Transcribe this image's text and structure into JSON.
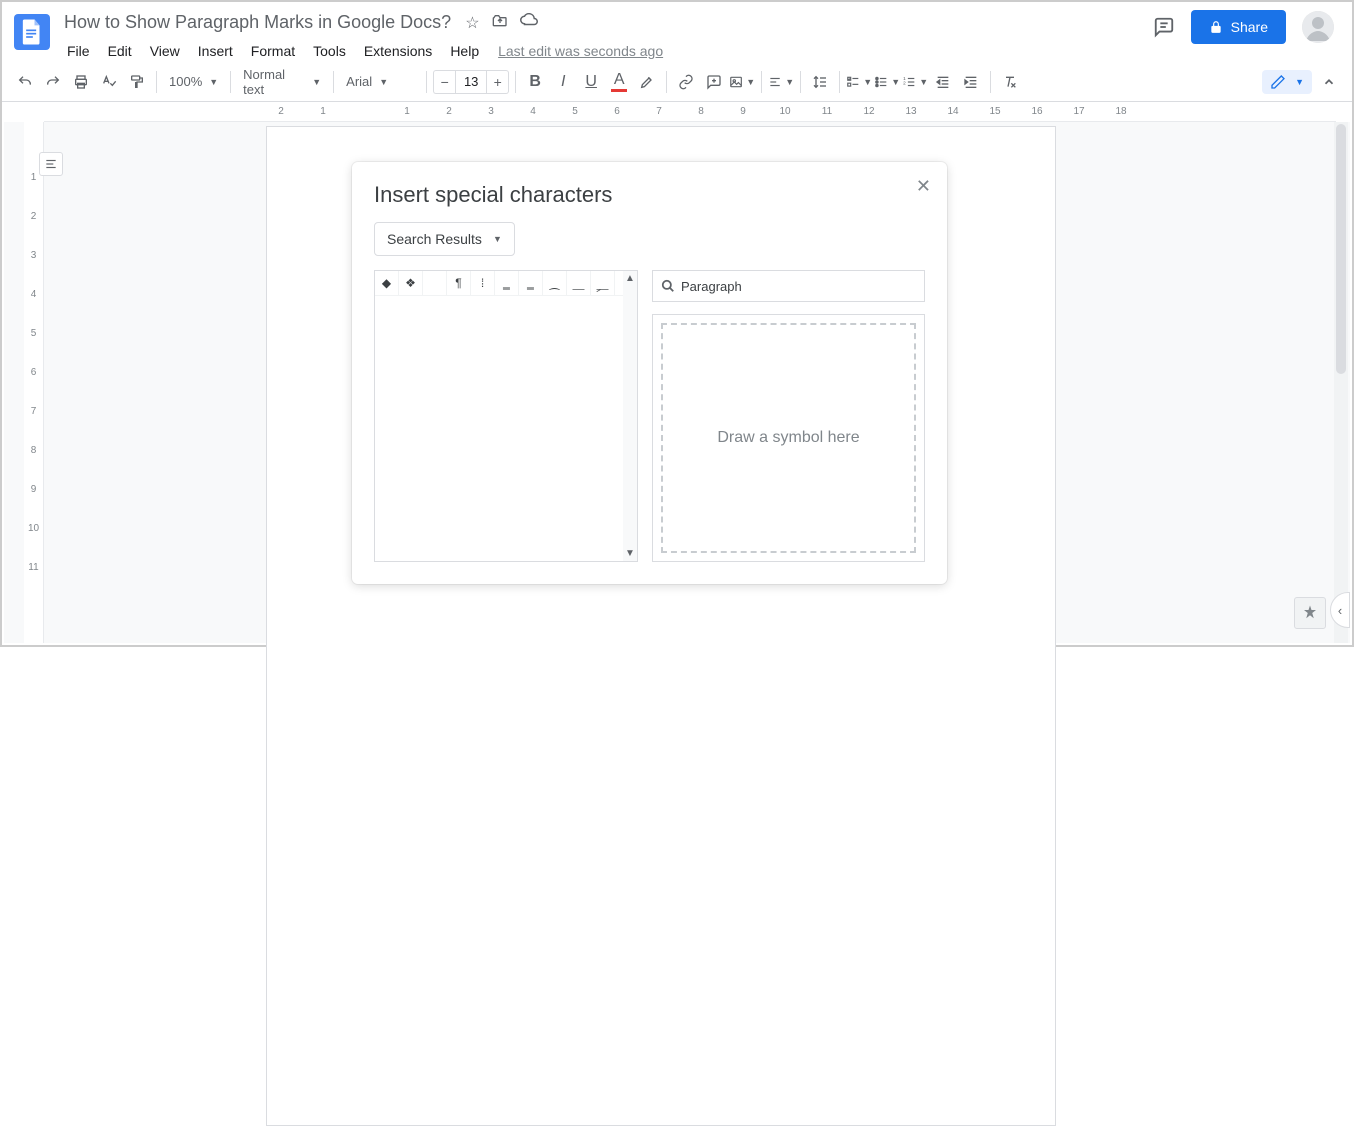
{
  "doc": {
    "title": "How to Show Paragraph Marks in Google Docs?",
    "last_edit": "Last edit was seconds ago"
  },
  "menus": [
    "File",
    "Edit",
    "View",
    "Insert",
    "Format",
    "Tools",
    "Extensions",
    "Help"
  ],
  "share_label": "Share",
  "toolbar": {
    "zoom": "100%",
    "style": "Normal text",
    "font": "Arial",
    "fontsize": "13"
  },
  "ruler_numbers": [
    "2",
    "1",
    "",
    "1",
    "2",
    "3",
    "4",
    "5",
    "6",
    "7",
    "8",
    "9",
    "10",
    "11",
    "12",
    "13",
    "14",
    "15",
    "16",
    "17",
    "18"
  ],
  "vruler_numbers": [
    "",
    "1",
    "2",
    "3",
    "4",
    "5",
    "6",
    "7",
    "8",
    "9",
    "10",
    "11"
  ],
  "dialog": {
    "title": "Insert special characters",
    "category": "Search Results",
    "search_value": "Paragraph",
    "draw_hint": "Draw a symbol here",
    "chars": [
      "◆",
      "❖",
      "",
      "¶",
      "⁞",
      "‗",
      "‗",
      "⁔",
      "⸏",
      "⸐"
    ]
  }
}
